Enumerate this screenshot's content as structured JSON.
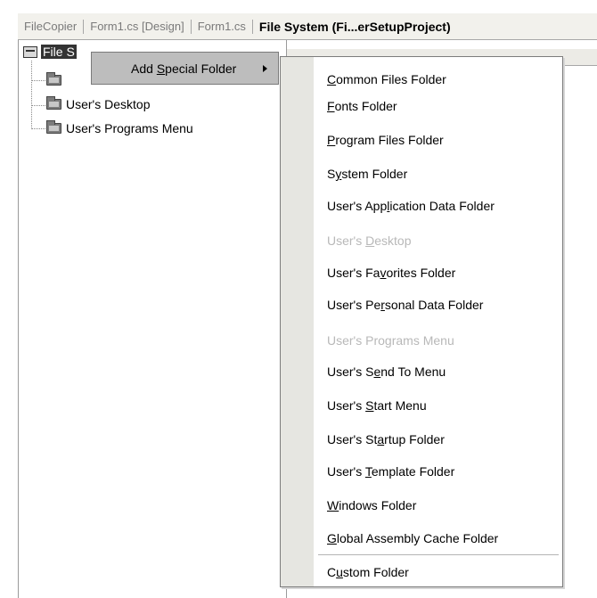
{
  "tabs": [
    {
      "label": "FileCopier",
      "active": false
    },
    {
      "label": "Form1.cs [Design]",
      "active": false
    },
    {
      "label": "Form1.cs",
      "active": false
    },
    {
      "label": "File System (Fi...erSetupProject)",
      "active": true
    }
  ],
  "tree": {
    "root_label": "File S",
    "items": [
      {
        "label": "",
        "icon": "folder-icon"
      },
      {
        "label": "User's Desktop",
        "icon": "folder-icon"
      },
      {
        "label": "User's Programs Menu",
        "icon": "folder-icon"
      }
    ]
  },
  "context_menu": {
    "item": {
      "label": "Add Special Folder",
      "mnemonic_index": 4,
      "has_submenu": true
    }
  },
  "submenu": {
    "items": [
      {
        "label": "Common Files Folder",
        "mnemonic_index": 0,
        "disabled": false
      },
      {
        "label": "Fonts Folder",
        "mnemonic_index": 0,
        "disabled": false
      },
      {
        "label": "Program Files Folder",
        "mnemonic_index": 0,
        "disabled": false
      },
      {
        "label": "System Folder",
        "mnemonic_index": 1,
        "disabled": false
      },
      {
        "label": "User's Application Data Folder",
        "mnemonic_index": 10,
        "disabled": false
      },
      {
        "label": "User's Desktop",
        "mnemonic_index": 7,
        "disabled": true
      },
      {
        "label": "User's Favorites Folder",
        "mnemonic_index": 9,
        "disabled": false
      },
      {
        "label": "User's Personal Data Folder",
        "mnemonic_index": 9,
        "disabled": false
      },
      {
        "label": "User's Programs Menu",
        "mnemonic_index": 10,
        "disabled": true
      },
      {
        "label": "User's Send To Menu",
        "mnemonic_index": 8,
        "disabled": false
      },
      {
        "label": "User's Start Menu",
        "mnemonic_index": 7,
        "disabled": false
      },
      {
        "label": "User's Startup Folder",
        "mnemonic_index": 9,
        "disabled": false
      },
      {
        "label": "User's Template Folder",
        "mnemonic_index": 7,
        "disabled": false
      },
      {
        "label": "Windows Folder",
        "mnemonic_index": 0,
        "disabled": false
      },
      {
        "label": "Global Assembly Cache Folder",
        "mnemonic_index": 0,
        "disabled": false
      },
      {
        "separator": true
      },
      {
        "label": "Custom Folder",
        "mnemonic_index": 1,
        "disabled": false
      }
    ]
  }
}
